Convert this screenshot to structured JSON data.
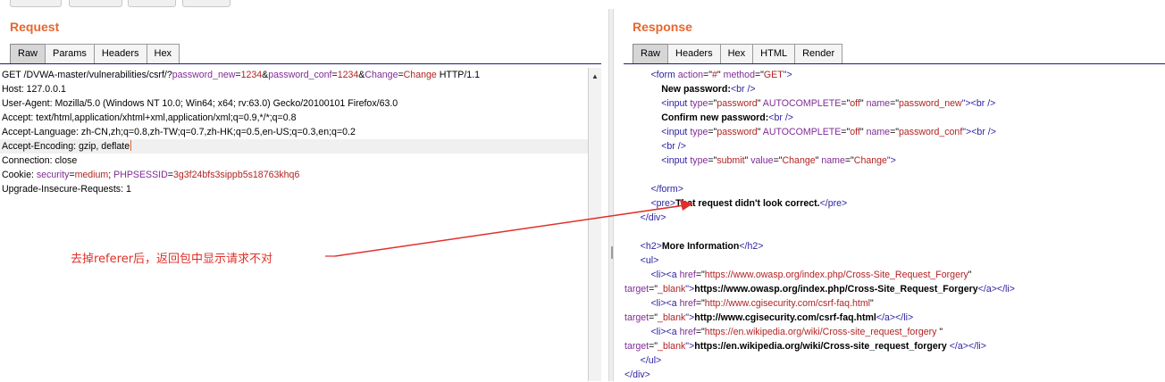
{
  "request": {
    "title": "Request",
    "tabs": [
      "Raw",
      "Params",
      "Headers",
      "Hex"
    ],
    "lines": [
      [
        [
          "GET /DVWA-master/vulnerabilities/csrf/?",
          ""
        ],
        [
          "password_new",
          "kw"
        ],
        [
          "=",
          ""
        ],
        [
          "1234",
          "val"
        ],
        [
          "&",
          ""
        ],
        [
          "password_conf",
          "kw"
        ],
        [
          "=",
          ""
        ],
        [
          "1234",
          "val"
        ],
        [
          "&",
          ""
        ],
        [
          "Change",
          "kw"
        ],
        [
          "=",
          ""
        ],
        [
          "Change",
          "val"
        ],
        [
          " HTTP/1.1",
          ""
        ]
      ],
      [
        [
          "Host: 127.0.0.1",
          ""
        ]
      ],
      [
        [
          "User-Agent: Mozilla/5.0 (Windows NT 10.0; Win64; x64; rv:63.0) Gecko/20100101 Firefox/63.0",
          ""
        ]
      ],
      [
        [
          "Accept: text/html,application/xhtml+xml,application/xml;q=0.9,*/*;q=0.8",
          ""
        ]
      ],
      [
        [
          "Accept-Language: zh-CN,zh;q=0.8,zh-TW;q=0.7,zh-HK;q=0.5,en-US;q=0.3,en;q=0.2",
          ""
        ]
      ],
      [
        [
          "Accept-Encoding: gzip, deflate",
          ""
        ]
      ],
      [
        [
          "Connection: close",
          ""
        ]
      ],
      [
        [
          "Cookie: ",
          ""
        ],
        [
          "security",
          "kw"
        ],
        [
          "=",
          ""
        ],
        [
          "medium",
          "val"
        ],
        [
          "; ",
          ""
        ],
        [
          "PHPSESSID",
          "kw"
        ],
        [
          "=",
          ""
        ],
        [
          "3g3f24bfs3sippb5s18763khq6",
          "val"
        ]
      ],
      [
        [
          "Upgrade-Insecure-Requests: 1",
          ""
        ]
      ]
    ]
  },
  "response": {
    "title": "Response",
    "tabs": [
      "Raw",
      "Headers",
      "Hex",
      "HTML",
      "Render"
    ],
    "lines": [
      [
        [
          "          ",
          ""
        ],
        [
          "<form ",
          "tag"
        ],
        [
          "action",
          "attr"
        ],
        [
          "=\"",
          ""
        ],
        [
          "#",
          "str"
        ],
        [
          "\" ",
          ""
        ],
        [
          "method",
          "attr"
        ],
        [
          "=\"",
          ""
        ],
        [
          "GET",
          "str"
        ],
        [
          "\">",
          "tag"
        ]
      ],
      [
        [
          "              ",
          ""
        ],
        [
          "New password:",
          "b"
        ],
        [
          "<br />",
          "tag"
        ]
      ],
      [
        [
          "              ",
          ""
        ],
        [
          "<input ",
          "tag"
        ],
        [
          "type",
          "attr"
        ],
        [
          "=\"",
          ""
        ],
        [
          "password",
          "str"
        ],
        [
          "\" ",
          ""
        ],
        [
          "AUTOCOMPLETE",
          "attr"
        ],
        [
          "=\"",
          ""
        ],
        [
          "off",
          "str"
        ],
        [
          "\" ",
          ""
        ],
        [
          "name",
          "attr"
        ],
        [
          "=\"",
          ""
        ],
        [
          "password_new",
          "str"
        ],
        [
          "\">",
          "tag"
        ],
        [
          "<br />",
          "tag"
        ]
      ],
      [
        [
          "              ",
          ""
        ],
        [
          "Confirm new password:",
          "b"
        ],
        [
          "<br />",
          "tag"
        ]
      ],
      [
        [
          "              ",
          ""
        ],
        [
          "<input ",
          "tag"
        ],
        [
          "type",
          "attr"
        ],
        [
          "=\"",
          ""
        ],
        [
          "password",
          "str"
        ],
        [
          "\" ",
          ""
        ],
        [
          "AUTOCOMPLETE",
          "attr"
        ],
        [
          "=\"",
          ""
        ],
        [
          "off",
          "str"
        ],
        [
          "\" ",
          ""
        ],
        [
          "name",
          "attr"
        ],
        [
          "=\"",
          ""
        ],
        [
          "password_conf",
          "str"
        ],
        [
          "\">",
          "tag"
        ],
        [
          "<br />",
          "tag"
        ]
      ],
      [
        [
          "              ",
          ""
        ],
        [
          "<br />",
          "tag"
        ]
      ],
      [
        [
          "              ",
          ""
        ],
        [
          "<input ",
          "tag"
        ],
        [
          "type",
          "attr"
        ],
        [
          "=\"",
          ""
        ],
        [
          "submit",
          "str"
        ],
        [
          "\" ",
          ""
        ],
        [
          "value",
          "attr"
        ],
        [
          "=\"",
          ""
        ],
        [
          "Change",
          "str"
        ],
        [
          "\" ",
          ""
        ],
        [
          "name",
          "attr"
        ],
        [
          "=\"",
          ""
        ],
        [
          "Change",
          "str"
        ],
        [
          "\">",
          "tag"
        ]
      ],
      [
        [
          "",
          ""
        ]
      ],
      [
        [
          "          ",
          ""
        ],
        [
          "</form>",
          "tag"
        ]
      ],
      [
        [
          "          ",
          ""
        ],
        [
          "<pre>",
          "tag"
        ],
        [
          "That request didn't look correct.",
          "b"
        ],
        [
          "</pre>",
          "tag"
        ]
      ],
      [
        [
          "      ",
          ""
        ],
        [
          "</div>",
          "tag"
        ]
      ],
      [
        [
          "",
          ""
        ]
      ],
      [
        [
          "      ",
          ""
        ],
        [
          "<h2>",
          "tag"
        ],
        [
          "More Information",
          "b"
        ],
        [
          "</h2>",
          "tag"
        ]
      ],
      [
        [
          "      ",
          ""
        ],
        [
          "<ul>",
          "tag"
        ]
      ],
      [
        [
          "          ",
          ""
        ],
        [
          "<li>",
          "tag"
        ],
        [
          "<a ",
          "tag"
        ],
        [
          "href",
          "attr"
        ],
        [
          "=\"",
          ""
        ],
        [
          "https://www.owasp.org/index.php/Cross-Site_Request_Forgery",
          "str"
        ],
        [
          "\"",
          ""
        ]
      ],
      [
        [
          "target",
          "attr"
        ],
        [
          "=\"",
          ""
        ],
        [
          "_blank",
          "str"
        ],
        [
          "\">",
          "tag"
        ],
        [
          "https://www.owasp.org/index.php/Cross-Site_Request_Forgery",
          "b"
        ],
        [
          "</a>",
          "tag"
        ],
        [
          "</li>",
          "tag"
        ]
      ],
      [
        [
          "          ",
          ""
        ],
        [
          "<li>",
          "tag"
        ],
        [
          "<a ",
          "tag"
        ],
        [
          "href",
          "attr"
        ],
        [
          "=\"",
          ""
        ],
        [
          "http://www.cgisecurity.com/csrf-faq.html",
          "str"
        ],
        [
          "\"",
          ""
        ]
      ],
      [
        [
          "target",
          "attr"
        ],
        [
          "=\"",
          ""
        ],
        [
          "_blank",
          "str"
        ],
        [
          "\">",
          "tag"
        ],
        [
          "http://www.cgisecurity.com/csrf-faq.html",
          "b"
        ],
        [
          "</a>",
          "tag"
        ],
        [
          "</li>",
          "tag"
        ]
      ],
      [
        [
          "          ",
          ""
        ],
        [
          "<li>",
          "tag"
        ],
        [
          "<a ",
          "tag"
        ],
        [
          "href",
          "attr"
        ],
        [
          "=\"",
          ""
        ],
        [
          "https://en.wikipedia.org/wiki/Cross-site_request_forgery ",
          "str"
        ],
        [
          "\"",
          ""
        ]
      ],
      [
        [
          "target",
          "attr"
        ],
        [
          "=\"",
          ""
        ],
        [
          "_blank",
          "str"
        ],
        [
          "\">",
          "tag"
        ],
        [
          "https://en.wikipedia.org/wiki/Cross-site_request_forgery ",
          "b"
        ],
        [
          "</a>",
          "tag"
        ],
        [
          "</li>",
          "tag"
        ]
      ],
      [
        [
          "      ",
          ""
        ],
        [
          "</ul>",
          "tag"
        ]
      ],
      [
        [
          "",
          ""
        ],
        [
          "</div>",
          "tag"
        ]
      ]
    ]
  },
  "annotation": "去掉referer后，返回包中显示请求不对",
  "colors": {
    "accent": "#e8662f",
    "annotation": "#e0302a"
  }
}
